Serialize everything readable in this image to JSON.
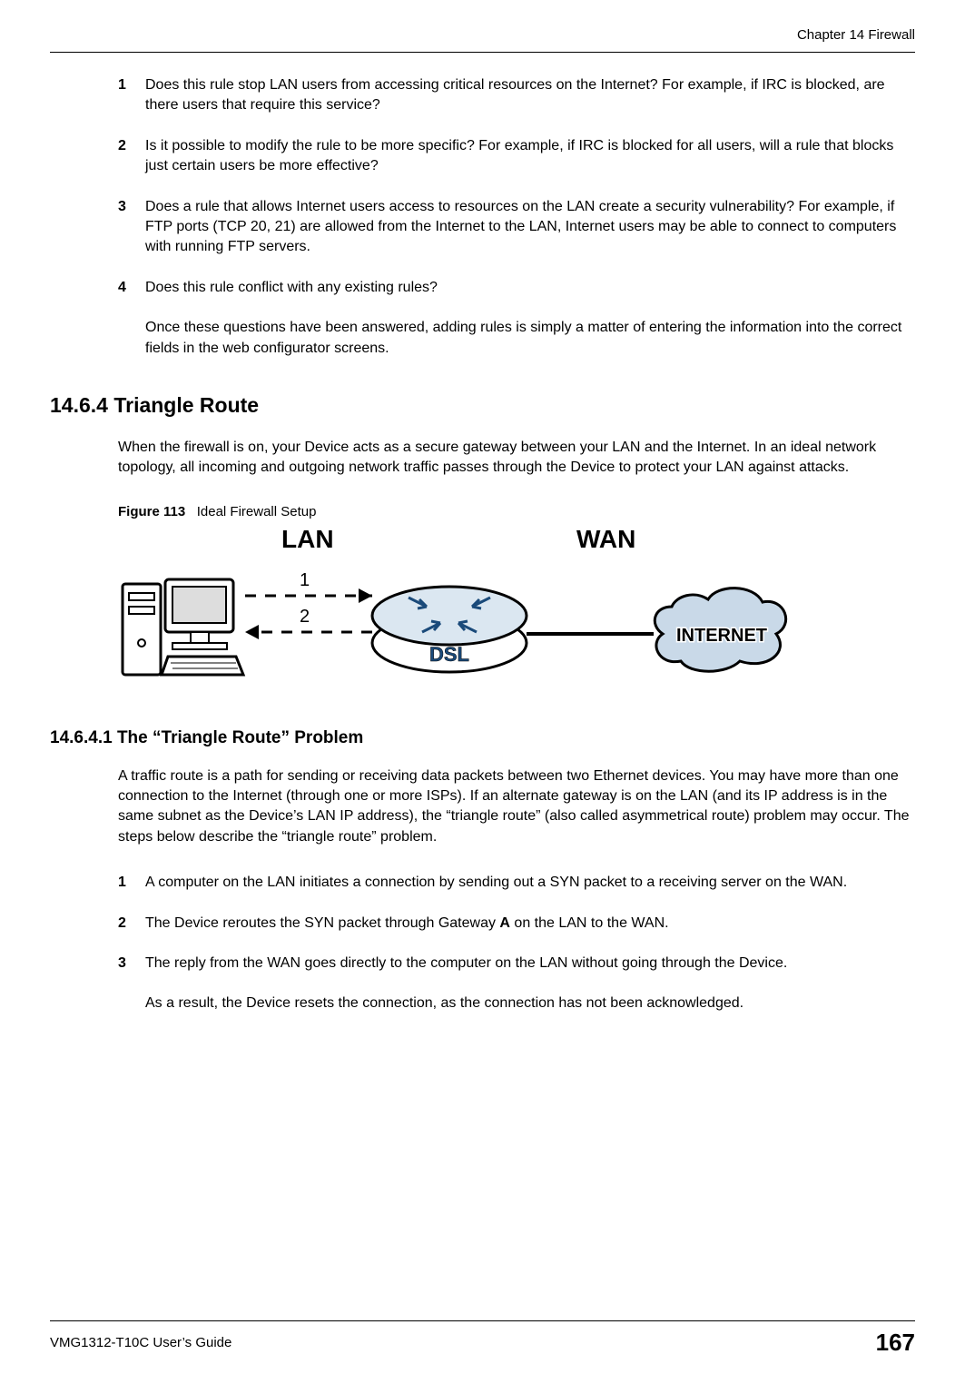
{
  "header": {
    "chapter": "Chapter 14 Firewall"
  },
  "questions": {
    "items": [
      {
        "num": "1",
        "text": "Does this rule stop LAN users from accessing critical resources on the Internet? For example, if IRC is blocked, are there users that require this service?"
      },
      {
        "num": "2",
        "text": "Is it possible to modify the rule to be more specific? For example, if IRC is blocked for all users, will a rule that blocks just certain users be more effective?"
      },
      {
        "num": "3",
        "text": "Does a rule that allows Internet users access to resources on the LAN create a security vulnerability? For example, if FTP ports (TCP 20, 21) are allowed from the Internet to the LAN, Internet users may be able to connect to computers with running FTP servers."
      },
      {
        "num": "4",
        "text": "Does this rule conflict with any existing rules?"
      }
    ],
    "closing": "Once these questions have been answered, adding rules is simply a matter of entering the information into the correct fields in the web configurator screens."
  },
  "section": {
    "heading": "14.6.4  Triangle Route",
    "intro": "When the firewall is on, your Device acts as a secure gateway between your LAN and the Internet. In an ideal network topology, all incoming and outgoing network traffic passes through the Device to protect your LAN against attacks."
  },
  "figure": {
    "label": "Figure 113",
    "title": "Ideal Firewall Setup",
    "labels": {
      "lan": "LAN",
      "wan": "WAN",
      "one": "1",
      "two": "2"
    }
  },
  "subsection": {
    "heading": "14.6.4.1  The “Triangle Route” Problem",
    "intro": "A traffic route is a path for sending or receiving data packets between two Ethernet devices. You may have more than one connection to the Internet (through one or more ISPs). If an alternate gateway is on the LAN (and its IP address is in the same subnet as the Device’s LAN IP address), the “triangle route” (also called asymmetrical route) problem may occur. The steps below describe the “triangle route” problem.",
    "items": [
      {
        "num": "1",
        "text": "A computer on the LAN initiates a connection by sending out a SYN packet to a receiving server on the WAN."
      },
      {
        "num": "2",
        "text_pre": "The Device reroutes the SYN packet through Gateway ",
        "bold": "A",
        "text_post": " on the LAN to the WAN."
      },
      {
        "num": "3",
        "text": "The reply from the WAN goes directly to the computer on the LAN without going through the Device."
      }
    ],
    "closing": "As a result, the Device resets the connection, as the connection has not been acknowledged."
  },
  "footer": {
    "guide": "VMG1312-T10C User’s Guide",
    "page": "167"
  }
}
